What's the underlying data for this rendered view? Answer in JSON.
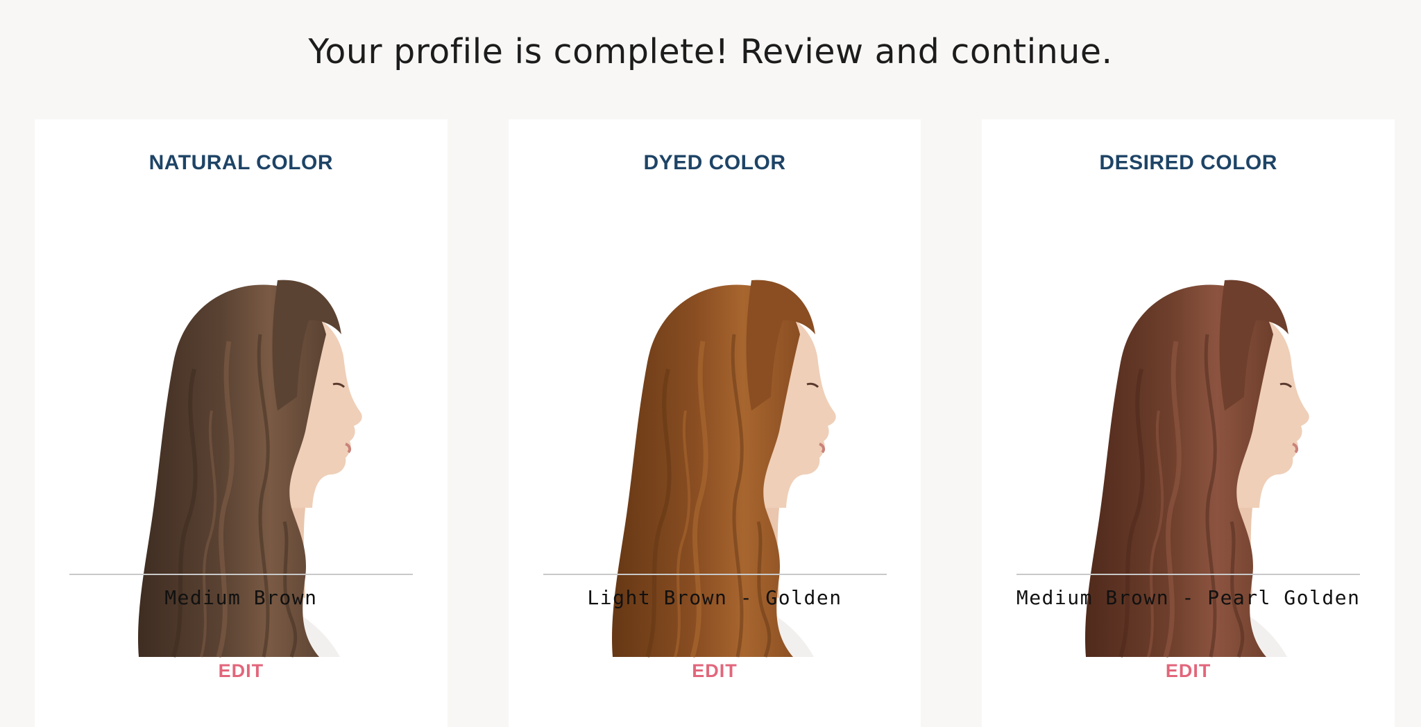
{
  "page": {
    "title": "Your profile is complete! Review and continue."
  },
  "colors": {
    "title_text": "#1c1c1c",
    "card_heading": "#1e4466",
    "edit_link": "#e2667b",
    "page_background": "#f8f7f5"
  },
  "cards": [
    {
      "heading": "NATURAL COLOR",
      "color_name": "Medium Brown",
      "edit_label": "EDIT",
      "image": "woman-profile-medium-brown-hair",
      "hair_color": "#5b4333",
      "hair_highlight": "#7a5a44",
      "hair_shadow": "#3f2d22"
    },
    {
      "heading": "DYED COLOR",
      "color_name": "Light Brown - Golden",
      "edit_label": "EDIT",
      "image": "woman-profile-light-brown-golden-hair",
      "hair_color": "#8a4e22",
      "hair_highlight": "#a8662f",
      "hair_shadow": "#663815"
    },
    {
      "heading": "DESIRED COLOR",
      "color_name": "Medium Brown - Pearl Golden",
      "edit_label": "EDIT",
      "image": "woman-profile-medium-brown-pearl-golden-hair",
      "hair_color": "#6e3f2c",
      "hair_highlight": "#8c5440",
      "hair_shadow": "#502a1c"
    }
  ]
}
